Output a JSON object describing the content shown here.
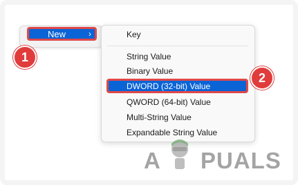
{
  "context_menu": {
    "new_label": "New",
    "new_chevron": "›"
  },
  "submenu": {
    "items": [
      {
        "label": "Key"
      },
      {
        "label": "String Value"
      },
      {
        "label": "Binary Value"
      },
      {
        "label": "DWORD (32-bit) Value"
      },
      {
        "label": "QWORD (64-bit) Value"
      },
      {
        "label": "Multi-String Value"
      },
      {
        "label": "Expandable String Value"
      }
    ]
  },
  "badges": {
    "step1": "1",
    "step2": "2"
  },
  "watermark": {
    "prefix": "A",
    "suffix": "PUALS"
  },
  "colors": {
    "highlight": "#0a64d6",
    "annotation_red": "#e04848"
  }
}
